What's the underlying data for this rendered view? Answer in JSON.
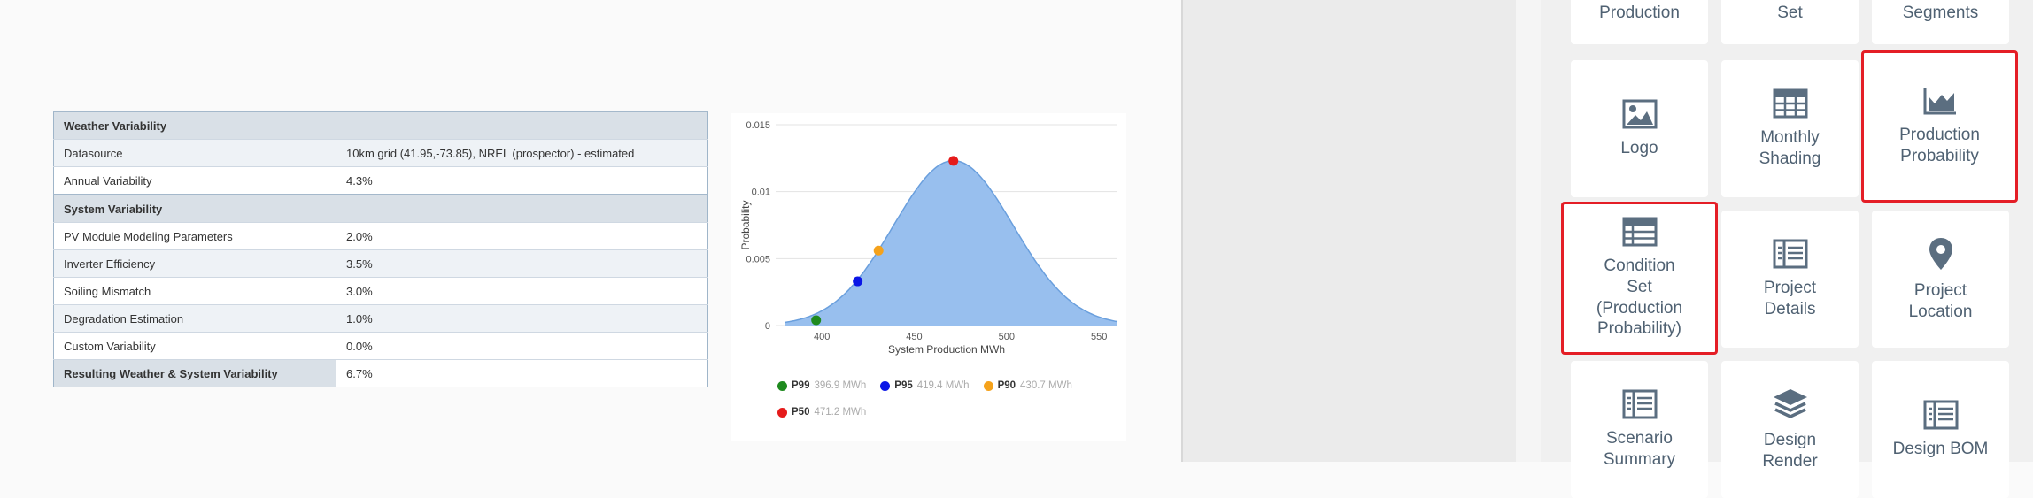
{
  "table": {
    "rows": [
      {
        "label": "Weather Variability",
        "value": ""
      },
      {
        "label": "Datasource",
        "value": "10km grid (41.95,-73.85), NREL (prospector) - estimated"
      },
      {
        "label": "Annual Variability",
        "value": "4.3%"
      },
      {
        "label": "System Variability",
        "value": ""
      },
      {
        "label": "PV Module Modeling Parameters",
        "value": "2.0%"
      },
      {
        "label": "Inverter Efficiency",
        "value": "3.5%"
      },
      {
        "label": "Soiling Mismatch",
        "value": "3.0%"
      },
      {
        "label": "Degradation Estimation",
        "value": "1.0%"
      },
      {
        "label": "Custom Variability",
        "value": "0.0%"
      },
      {
        "label": "Resulting Weather & System Variability",
        "value": "6.7%"
      }
    ]
  },
  "chart_data": {
    "type": "area",
    "xlabel": "System Production MWh",
    "ylabel": "Probability",
    "xlim": [
      375,
      560
    ],
    "ylim": [
      0,
      0.015
    ],
    "x_ticks": [
      400,
      450,
      500,
      550
    ],
    "y_ticks": [
      0,
      0.005,
      0.01,
      0.015
    ],
    "y_tick_labels": [
      "0",
      "0.005",
      "0.01",
      "0.015"
    ],
    "distribution": {
      "mean": 471.2,
      "std": 32.4
    },
    "grid": true,
    "fill_color": "#98bfee",
    "line_color": "#6a9fdd",
    "points": [
      {
        "name": "P99",
        "x": 396.9,
        "y": 0.0004,
        "label": "396.9 MWh",
        "color": "#1e8a1e"
      },
      {
        "name": "P95",
        "x": 419.4,
        "y": 0.0033,
        "label": "419.4 MWh",
        "color": "#0b16e6"
      },
      {
        "name": "P90",
        "x": 430.7,
        "y": 0.0056,
        "label": "430.7 MWh",
        "color": "#f5a21b"
      },
      {
        "name": "P50",
        "x": 471.2,
        "y": 0.0123,
        "label": "471.2 MWh",
        "color": "#e51b1b"
      }
    ]
  },
  "tiles": [
    {
      "id": "production",
      "label": "Production",
      "icon": "none",
      "selected": false
    },
    {
      "id": "set",
      "label": "Set",
      "icon": "none",
      "selected": false
    },
    {
      "id": "segments",
      "label": "Segments",
      "icon": "none",
      "selected": false
    },
    {
      "id": "logo",
      "label": "Logo",
      "icon": "image-icon",
      "selected": false
    },
    {
      "id": "monthly-shading",
      "label": "Monthly\nShading",
      "icon": "table-icon",
      "selected": false
    },
    {
      "id": "production-probability",
      "label": "Production\nProbability",
      "icon": "area-chart-icon",
      "selected": true
    },
    {
      "id": "condition-set-production-probability",
      "label": "Condition\nSet\n(Production\nProbability)",
      "icon": "table-icon",
      "selected": true
    },
    {
      "id": "project-details",
      "label": "Project\nDetails",
      "icon": "list-table-icon",
      "selected": false
    },
    {
      "id": "project-location",
      "label": "Project\nLocation",
      "icon": "map-pin-icon",
      "selected": false
    },
    {
      "id": "scenario-summary",
      "label": "Scenario\nSummary",
      "icon": "list-table-icon",
      "selected": false
    },
    {
      "id": "design-render",
      "label": "Design\nRender",
      "icon": "layers-icon",
      "selected": false
    },
    {
      "id": "design-bom",
      "label": "Design BOM",
      "icon": "list-table-icon",
      "selected": false
    }
  ],
  "colors": {
    "tile_text": "#4f6172",
    "selection_border": "#e41e26",
    "table_header": "#d9e0e7"
  }
}
